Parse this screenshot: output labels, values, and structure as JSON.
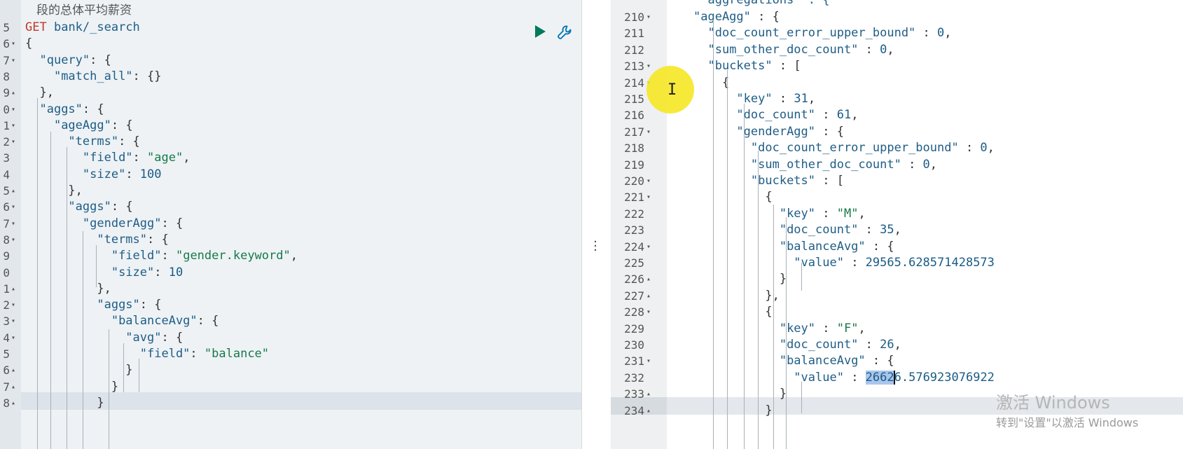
{
  "left_editor": {
    "comment": "段的总体平均薪资",
    "lines": [
      {
        "num": "5",
        "fold": "",
        "html": "<span class='get'>GET</span> <span class='k'>bank/_search</span>"
      },
      {
        "num": "6",
        "fold": "▾",
        "html": "<span class='p'>{</span>"
      },
      {
        "num": "7",
        "fold": "▾",
        "html": "  <span class='k'>\"query\"</span><span class='p'>: {</span>"
      },
      {
        "num": "8",
        "fold": "",
        "html": "    <span class='k'>\"match_all\"</span><span class='p'>: {}</span>"
      },
      {
        "num": "9",
        "fold": "▴",
        "html": "  <span class='p'>},</span>"
      },
      {
        "num": "0",
        "fold": "▾",
        "html": "  <span class='k'>\"aggs\"</span><span class='p'>: {</span>"
      },
      {
        "num": "1",
        "fold": "▾",
        "html": "    <span class='k'>\"ageAgg\"</span><span class='p'>: {</span>"
      },
      {
        "num": "2",
        "fold": "▾",
        "html": "      <span class='k'>\"terms\"</span><span class='p'>: {</span>"
      },
      {
        "num": "3",
        "fold": "",
        "html": "        <span class='k'>\"field\"</span><span class='p'>: </span><span class='s'>\"age\"</span><span class='p'>,</span>"
      },
      {
        "num": "4",
        "fold": "",
        "html": "        <span class='k'>\"size\"</span><span class='p'>: </span><span class='n'>100</span>"
      },
      {
        "num": "5",
        "fold": "▴",
        "html": "      <span class='p'>},</span>"
      },
      {
        "num": "6",
        "fold": "▾",
        "html": "      <span class='k'>\"aggs\"</span><span class='p'>: {</span>"
      },
      {
        "num": "7",
        "fold": "▾",
        "html": "        <span class='k'>\"genderAgg\"</span><span class='p'>: {</span>"
      },
      {
        "num": "8",
        "fold": "▾",
        "html": "          <span class='k'>\"terms\"</span><span class='p'>: {</span>"
      },
      {
        "num": "9",
        "fold": "",
        "html": "            <span class='k'>\"field\"</span><span class='p'>: </span><span class='s'>\"gender.keyword\"</span><span class='p'>,</span>"
      },
      {
        "num": "0",
        "fold": "",
        "html": "            <span class='k'>\"size\"</span><span class='p'>: </span><span class='n'>10</span>"
      },
      {
        "num": "1",
        "fold": "▴",
        "html": "          <span class='p'>},</span>"
      },
      {
        "num": "2",
        "fold": "▾",
        "html": "          <span class='k'>\"aggs\"</span><span class='p'>: {</span>"
      },
      {
        "num": "3",
        "fold": "▾",
        "html": "            <span class='k'>\"balanceAvg\"</span><span class='p'>: {</span>"
      },
      {
        "num": "4",
        "fold": "▾",
        "html": "              <span class='k'>\"avg\"</span><span class='p'>: {</span>"
      },
      {
        "num": "5",
        "fold": "",
        "html": "                <span class='k'>\"field\"</span><span class='p'>: </span><span class='s'>\"balance\"</span>"
      },
      {
        "num": "6",
        "fold": "▴",
        "html": "              <span class='p'>}</span>"
      },
      {
        "num": "7",
        "fold": "▴",
        "html": "            <span class='p'>}</span>"
      },
      {
        "num": "8",
        "fold": "▴",
        "html": "          <span class='p'>}</span>"
      }
    ]
  },
  "right_editor": {
    "top_partial": "  aggregations\" : {",
    "lines": [
      {
        "num": "210",
        "fold": "▾",
        "html": "<span class='k'>\"ageAgg\"</span><span class='p'> : {</span>"
      },
      {
        "num": "211",
        "fold": "",
        "html": "  <span class='k'>\"doc_count_error_upper_bound\"</span><span class='p'> : </span><span class='n'>0</span><span class='p'>,</span>"
      },
      {
        "num": "212",
        "fold": "",
        "html": "  <span class='k'>\"sum_other_doc_count\"</span><span class='p'> : </span><span class='n'>0</span><span class='p'>,</span>"
      },
      {
        "num": "213",
        "fold": "▾",
        "html": "  <span class='k'>\"buckets\"</span><span class='p'> : [</span>"
      },
      {
        "num": "214",
        "fold": "▾",
        "html": "    <span class='p'>{</span>"
      },
      {
        "num": "215",
        "fold": "",
        "html": "      <span class='k'>\"key\"</span><span class='p'> : </span><span class='n'>31</span><span class='p'>,</span>"
      },
      {
        "num": "216",
        "fold": "",
        "html": "      <span class='k'>\"doc_count\"</span><span class='p'> : </span><span class='n'>61</span><span class='p'>,</span>"
      },
      {
        "num": "217",
        "fold": "▾",
        "html": "      <span class='k'>\"genderAgg\"</span><span class='p'> : {</span>"
      },
      {
        "num": "218",
        "fold": "",
        "html": "        <span class='k'>\"doc_count_error_upper_bound\"</span><span class='p'> : </span><span class='n'>0</span><span class='p'>,</span>"
      },
      {
        "num": "219",
        "fold": "",
        "html": "        <span class='k'>\"sum_other_doc_count\"</span><span class='p'> : </span><span class='n'>0</span><span class='p'>,</span>"
      },
      {
        "num": "220",
        "fold": "▾",
        "html": "        <span class='k'>\"buckets\"</span><span class='p'> : [</span>"
      },
      {
        "num": "221",
        "fold": "▾",
        "html": "          <span class='p'>{</span>"
      },
      {
        "num": "222",
        "fold": "",
        "html": "            <span class='k'>\"key\"</span><span class='p'> : </span><span class='s'>\"M\"</span><span class='p'>,</span>"
      },
      {
        "num": "223",
        "fold": "",
        "html": "            <span class='k'>\"doc_count\"</span><span class='p'> : </span><span class='n'>35</span><span class='p'>,</span>"
      },
      {
        "num": "224",
        "fold": "▾",
        "html": "            <span class='k'>\"balanceAvg\"</span><span class='p'> : {</span>"
      },
      {
        "num": "225",
        "fold": "",
        "html": "              <span class='k'>\"value\"</span><span class='p'> : </span><span class='n'>29565.628571428573</span>"
      },
      {
        "num": "226",
        "fold": "▴",
        "html": "            <span class='p'>}</span>"
      },
      {
        "num": "227",
        "fold": "▴",
        "html": "          <span class='p'>},</span>"
      },
      {
        "num": "228",
        "fold": "▾",
        "html": "          <span class='p'>{</span>"
      },
      {
        "num": "229",
        "fold": "",
        "html": "            <span class='k'>\"key\"</span><span class='p'> : </span><span class='s'>\"F\"</span><span class='p'>,</span>"
      },
      {
        "num": "230",
        "fold": "",
        "html": "            <span class='k'>\"doc_count\"</span><span class='p'> : </span><span class='n'>26</span><span class='p'>,</span>"
      },
      {
        "num": "231",
        "fold": "▾",
        "html": "            <span class='k'>\"balanceAvg\"</span><span class='p'> : {</span>"
      },
      {
        "num": "232",
        "fold": "",
        "html": "              <span class='k'>\"value\"</span><span class='p'> : </span><span class='selected n'>2662</span><span class='text-caret'></span><span class='n'>6.576923076922</span>"
      },
      {
        "num": "233",
        "fold": "▴",
        "html": "            <span class='p'>}</span>"
      },
      {
        "num": "234",
        "fold": "▴",
        "html": "          <span class='p'>}</span>"
      }
    ]
  },
  "watermark": {
    "line1": "激活 Windows",
    "line2": "转到\"设置\"以激活 Windows"
  }
}
